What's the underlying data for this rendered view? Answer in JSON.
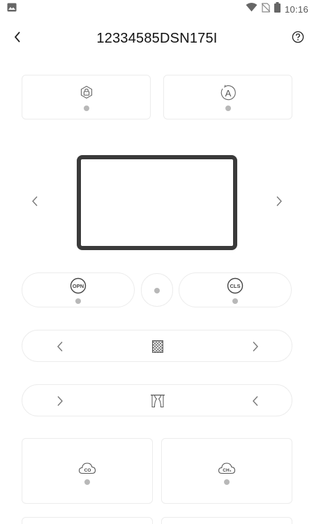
{
  "status_bar": {
    "time": "10:16",
    "icons": [
      "gallery-icon",
      "wifi-icon",
      "no-sim-icon",
      "battery-icon"
    ]
  },
  "header": {
    "title": "12334585DSN175I",
    "back_icon": "chevron-left-icon",
    "help_icon": "help-circle-icon"
  },
  "cards_top": [
    {
      "icon": "lock-icon",
      "status": "inactive"
    },
    {
      "icon": "auto-icon",
      "status": "inactive",
      "label": "A"
    }
  ],
  "screen": {
    "prev_icon": "chevron-left-icon",
    "next_icon": "chevron-right-icon"
  },
  "door_controls": {
    "open_label": "OPN",
    "close_label": "CLS"
  },
  "rows": [
    {
      "icon": "window-grid-icon",
      "left_arrow": "chevron-left-icon",
      "right_arrow": "chevron-right-icon"
    },
    {
      "icon": "curtain-icon",
      "left_arrow": "chevron-right-icon",
      "right_arrow": "chevron-left-icon"
    }
  ],
  "sensors": [
    {
      "label": "CO",
      "icon": "cloud-co-icon"
    },
    {
      "label": "CH₄",
      "icon": "cloud-ch4-icon"
    }
  ],
  "colors": {
    "frame": "#3a3a3a",
    "dot": "#b8b8b8",
    "border": "#ececec",
    "icon": "#666666"
  }
}
